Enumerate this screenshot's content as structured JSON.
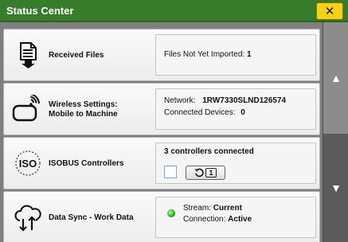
{
  "window": {
    "title": "Status Center",
    "close_label": "✕"
  },
  "rows": [
    {
      "label": "Received Files",
      "icon": "received-files-icon",
      "status_label": "Files Not Yet Imported:",
      "status_value": "1"
    },
    {
      "label_line1": "Wireless Settings:",
      "label_line2": "Mobile to Machine",
      "icon": "wireless-mobile-icon",
      "network_label": "Network:",
      "network_value": "1RW7330SLND126574",
      "devices_label": "Connected Devices:",
      "devices_value": "0"
    },
    {
      "label": "ISOBUS Controllers",
      "icon": "iso-icon",
      "iso_text": "ISO",
      "status_text": "3 controllers connected",
      "count_badge": "1"
    },
    {
      "label": "Data Sync - Work Data",
      "icon": "cloud-sync-icon",
      "stream_label": "Stream:",
      "stream_value": "Current",
      "connection_label": "Connection:",
      "connection_value": "Active"
    }
  ],
  "scrollbar": {
    "up": "▲",
    "down": "▼"
  },
  "colors": {
    "titlebar": "#367c2b",
    "close_button": "#f7d117",
    "status_led": "#1ea81e"
  }
}
